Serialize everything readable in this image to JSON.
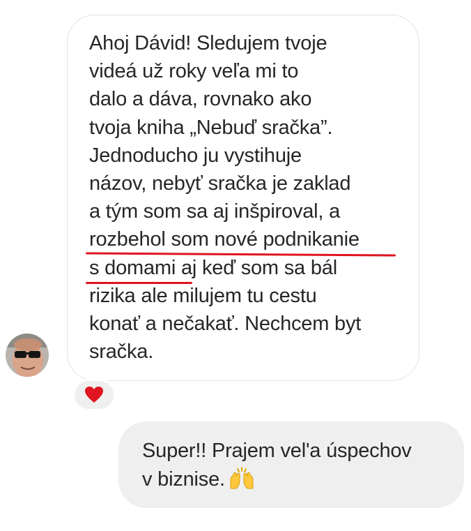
{
  "incoming_message": {
    "lines": [
      "Ahoj Dávid! Sledujem tvoje",
      "videá už roky veľa mi to",
      "dalo a dáva, rovnako ako",
      "tvoja kniha „Nebuď sračka”.",
      "Jednoducho ju vystihuje",
      "názov, nebyť sračka je zaklad",
      "a tým som sa aj inšpiroval, a",
      "rozbehol som nové podnikanie",
      "s domami",
      " aj keď som sa bál",
      "rizika ale milujem tu cestu",
      "konať a nečakať. Nechcem byt",
      "sračka."
    ],
    "highlight_color": "#e0151f"
  },
  "reaction": {
    "icon": "heart-icon",
    "color": "#e0151f"
  },
  "outgoing_message": {
    "lines": [
      "Super!! Prajem vel'a úspechov",
      "v biznise."
    ],
    "emoji_icon": "raising-hands-icon"
  },
  "colors": {
    "incoming_bubble_border": "#e3e3e3",
    "outgoing_bubble_bg": "#efefef",
    "text": "#262626"
  }
}
